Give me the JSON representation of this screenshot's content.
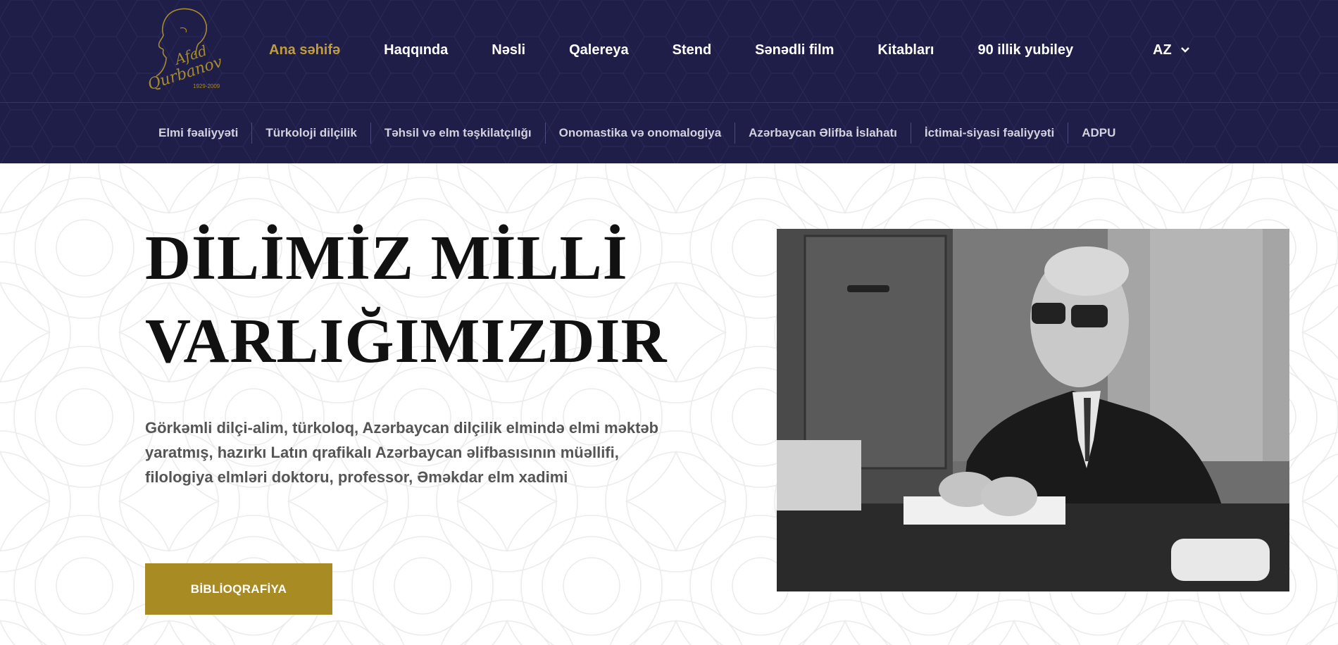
{
  "logo": {
    "name_line1": "Afad",
    "name_line2": "Qurbanov",
    "years": "1929-2009"
  },
  "nav": {
    "items": [
      {
        "label": "Ana səhifə",
        "active": true
      },
      {
        "label": "Haqqında",
        "active": false
      },
      {
        "label": "Nəsli",
        "active": false
      },
      {
        "label": "Qalereya",
        "active": false
      },
      {
        "label": "Stend",
        "active": false
      },
      {
        "label": "Sənədli film",
        "active": false
      },
      {
        "label": "Kitabları",
        "active": false
      },
      {
        "label": "90 illik yubiley",
        "active": false
      }
    ],
    "language": "AZ"
  },
  "subnav": {
    "items": [
      "Elmi fəaliyyəti",
      "Türkoloji dilçilik",
      "Təhsil və elm təşkilatçılığı",
      "Onomastika və onomalogiya",
      "Azərbaycan Əlifba İslahatı",
      "İctimai-siyasi fəaliyyəti",
      "ADPU"
    ]
  },
  "hero": {
    "title_line1": "DİLİMİZ MİLLİ",
    "title_line2": "VARLIĞIMIZDIR",
    "description": "Görkəmli dilçi-alim, türkoloq, Azərbaycan dilçilik elmində elmi məktəb yaratmış, hazırkı Latın qrafikalı Azərbaycan əlifbasısının müəllifi, filologiya elmləri doktoru, professor, Əməkdar elm xadimi",
    "button_label": "BİBLİOQRAFİYA"
  },
  "colors": {
    "header_bg": "#1f1e48",
    "accent_gold": "#c19c3a",
    "button_gold": "#a98b24"
  }
}
